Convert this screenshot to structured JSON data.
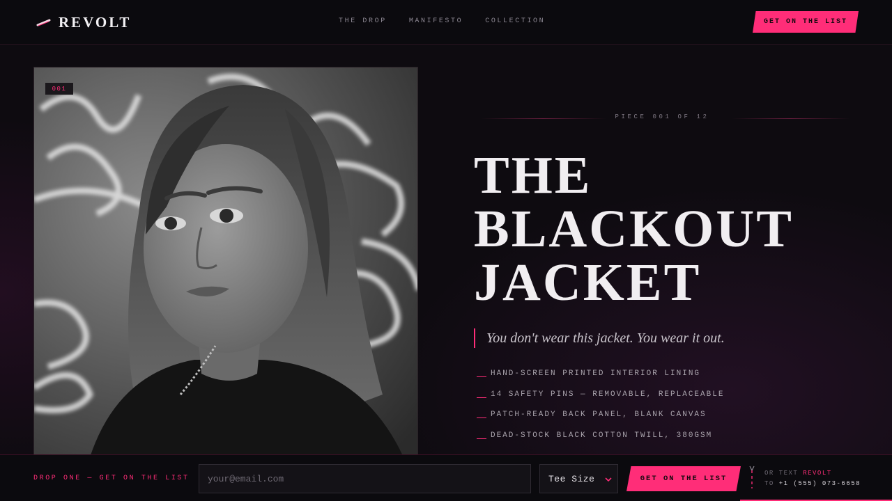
{
  "brand": {
    "name": "REVOLT",
    "accent": "#ff2d78",
    "icon": "safety-pin-icon"
  },
  "nav": {
    "items": [
      "THE DROP",
      "MANIFESTO",
      "COLLECTION"
    ]
  },
  "header": {
    "cta_label": "GET ON THE LIST"
  },
  "hero": {
    "photo_tag": "001",
    "piece_counter": "PIECE 001 OF 12",
    "title_lines": [
      "THE",
      "BLACKOUT",
      "JACKET"
    ],
    "tagline": "You don't wear this jacket. You wear it out.",
    "features": [
      "HAND-SCREEN PRINTED INTERIOR LINING",
      "14 SAFETY PINS — REMOVABLE, REPLACEABLE",
      "PATCH-READY BACK PANEL, BLANK CANVAS",
      "DEAD-STOCK BLACK COTTON TWILL, 380GSM"
    ]
  },
  "signup": {
    "label": "DROP ONE — GET ON THE LIST",
    "email_placeholder": "your@email.com",
    "size_selected": "Tee Size",
    "cta_label": "GET ON THE LIST",
    "text_prefix": "OR TEXT",
    "text_keyword": "REVOLT",
    "text_to": "TO",
    "phone": "+1 (555) 073-6658"
  }
}
